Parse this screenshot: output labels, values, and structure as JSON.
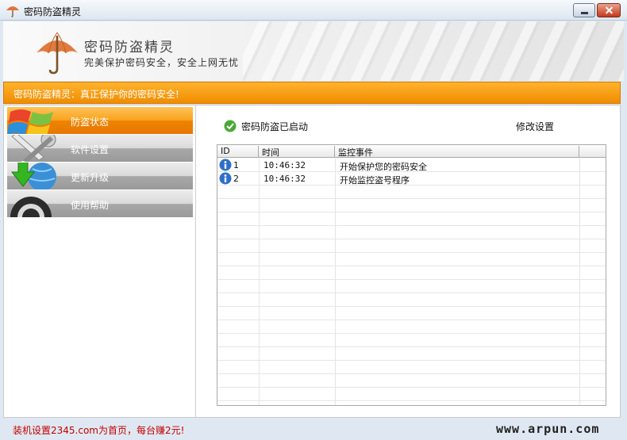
{
  "window": {
    "title": "密码防盗精灵"
  },
  "banner": {
    "title": "密码防盗精灵",
    "subtitle": "完美保护密码安全，安全上网无忧"
  },
  "slogan": "密码防盗精灵：真正保护你的密码安全!",
  "sidebar": {
    "items": [
      {
        "label": "防盗状态",
        "icon": "windows-flag-icon",
        "active": true
      },
      {
        "label": "软件设置",
        "icon": "wrench-icon",
        "active": false
      },
      {
        "label": "更新升级",
        "icon": "globe-download-icon",
        "active": false
      },
      {
        "label": "使用帮助",
        "icon": "help-ring-icon",
        "active": false
      }
    ]
  },
  "status": {
    "text": "密码防盗已启动",
    "icon": "check-circle-icon"
  },
  "settings_link": "修改设置",
  "table": {
    "columns": [
      "ID",
      "时间",
      "监控事件"
    ],
    "rows": [
      {
        "id": "1",
        "time": "10:46:32",
        "event": "开始保护您的密码安全",
        "icon": "info-icon"
      },
      {
        "id": "2",
        "time": "10:46:32",
        "event": "开始监控盗号程序",
        "icon": "info-icon"
      }
    ]
  },
  "footer": {
    "ad": "装机设置2345.com为首页，每台赚2元!",
    "watermark": "www.arpun.com"
  },
  "colors": {
    "accent": "#f08c00",
    "ad_text": "#c40000"
  }
}
